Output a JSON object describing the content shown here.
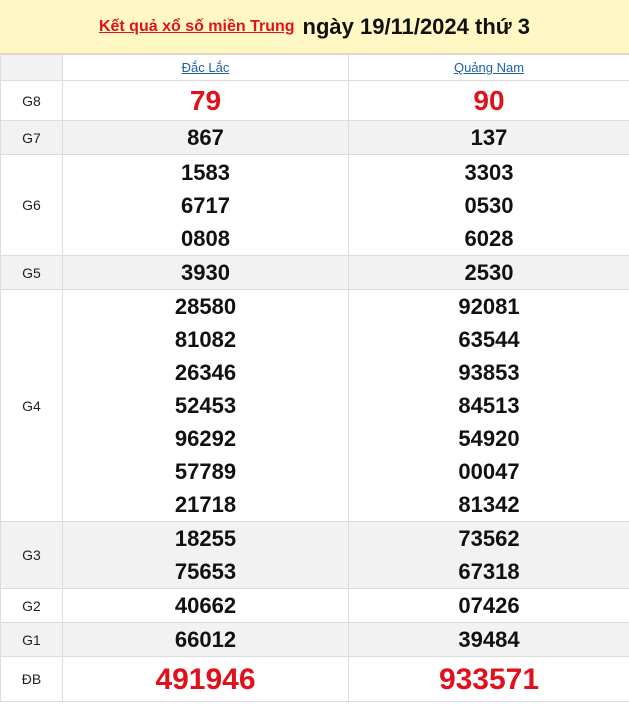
{
  "header": {
    "link_text": "Kết quả xổ số miền Trung",
    "date_text": "ngày 19/11/2024 thứ 3"
  },
  "provinces": [
    "Đắc Lắc",
    "Quảng Nam"
  ],
  "prizes": {
    "g8": {
      "label": "G8",
      "values": [
        [
          "79"
        ],
        [
          "90"
        ]
      ]
    },
    "g7": {
      "label": "G7",
      "values": [
        [
          "867"
        ],
        [
          "137"
        ]
      ]
    },
    "g6": {
      "label": "G6",
      "values": [
        [
          "1583",
          "6717",
          "0808"
        ],
        [
          "3303",
          "0530",
          "6028"
        ]
      ]
    },
    "g5": {
      "label": "G5",
      "values": [
        [
          "3930"
        ],
        [
          "2530"
        ]
      ]
    },
    "g4": {
      "label": "G4",
      "values": [
        [
          "28580",
          "81082",
          "26346",
          "52453",
          "96292",
          "57789",
          "21718"
        ],
        [
          "92081",
          "63544",
          "93853",
          "84513",
          "54920",
          "00047",
          "81342"
        ]
      ]
    },
    "g3": {
      "label": "G3",
      "values": [
        [
          "18255",
          "75653"
        ],
        [
          "73562",
          "67318"
        ]
      ]
    },
    "g2": {
      "label": "G2",
      "values": [
        [
          "40662"
        ],
        [
          "07426"
        ]
      ]
    },
    "g1": {
      "label": "G1",
      "values": [
        [
          "66012"
        ],
        [
          "39484"
        ]
      ]
    },
    "db": {
      "label": "ĐB",
      "values": [
        [
          "491946"
        ],
        [
          "933571"
        ]
      ]
    }
  },
  "colors": {
    "header_bg": "#fff8c5",
    "accent_red": "#e0111b",
    "link_blue": "#1f5fa8",
    "row_shade": "#f2f2f2"
  }
}
